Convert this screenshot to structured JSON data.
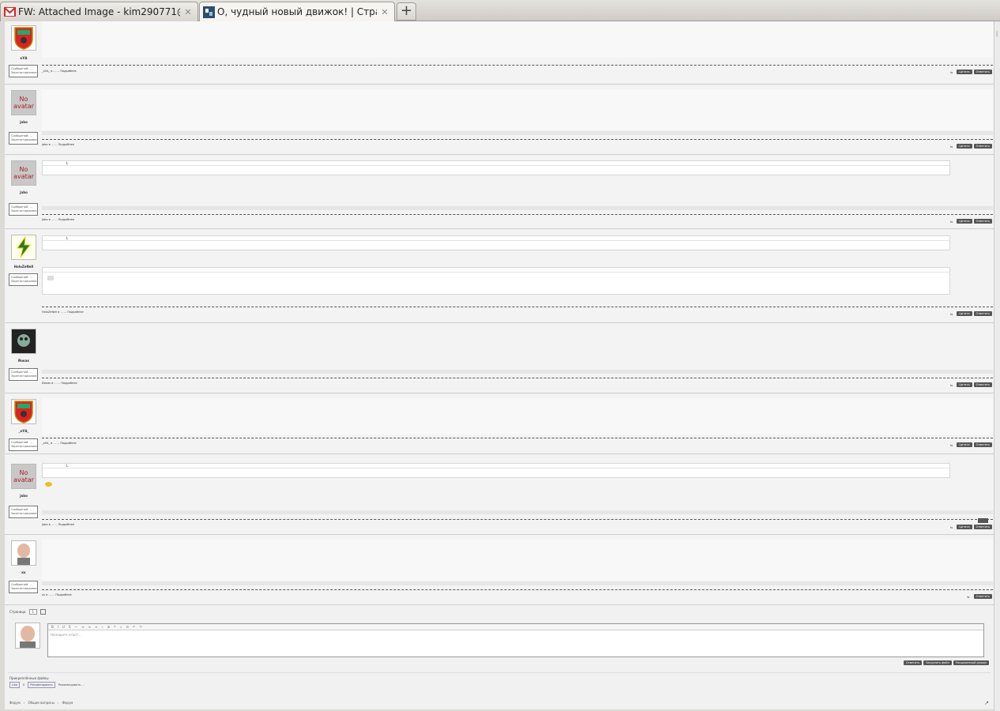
{
  "tabs": [
    {
      "title": "FW: Attached Image - kim290771@gmail...",
      "icon": "gmail-icon",
      "active": false
    },
    {
      "title": "О, чудный новый движок! | Страница ...",
      "icon": "site-icon",
      "active": true
    }
  ],
  "posts": [
    {
      "author": "кУА",
      "avatar": "coat-of-arms",
      "stats": [
        "Сообщений: ...",
        "Зарегистрирован: ..."
      ],
      "meta": "_кУА_ в ... ... Подробнее",
      "buttons": [
        "Цитата",
        "Ответить"
      ]
    },
    {
      "author": "jabo",
      "avatar": "no-avatar",
      "stats": [
        "Сообщений: ...",
        "Зарегистрирован: ..."
      ],
      "meta": "jabo в ... ... Подробнее",
      "buttons": [
        "Цитата",
        "Ответить"
      ]
    },
    {
      "author": "jabo",
      "avatar": "no-avatar",
      "stats": [
        "Сообщений: ...",
        "Зарегистрирован: ..."
      ],
      "meta": "jabo в ... ... Подробнее",
      "buttons": [
        "Цитата",
        "Ответить"
      ]
    },
    {
      "author": "HoloZeNell",
      "avatar": "lightning",
      "stats": [
        "Сообщений: ...",
        "Зарегистрирован: ..."
      ],
      "meta": "HoloZeNell в ... ... Подробнее",
      "buttons": [
        "Цитата",
        "Ответить"
      ]
    },
    {
      "author": "Йокак",
      "avatar": "dark",
      "stats": [
        "Сообщений: ...",
        "Зарегистрирован: ..."
      ],
      "meta": "Йокак в ... ... Подробнее",
      "buttons": [
        "Цитата",
        "Ответить"
      ]
    },
    {
      "author": "_кУА_",
      "avatar": "coat-of-arms",
      "stats": [
        "Сообщений: ...",
        "Зарегистрирован: ..."
      ],
      "meta": "_кУА_ в ... ... Подробнее",
      "buttons": [
        "Цитата",
        "Ответить"
      ]
    },
    {
      "author": "jabo",
      "avatar": "no-avatar",
      "stats": [
        "Сообщений: ...",
        "Зарегистрирован: ..."
      ],
      "meta": "jabo в ... ... Подробнее",
      "buttons": [
        "Цитата",
        "Ответить"
      ]
    },
    {
      "author": "кк",
      "avatar": "photo",
      "stats": [
        "Сообщений: ...",
        "Зарегистрирован: ..."
      ],
      "meta": "кк в ... ... Подробнее",
      "buttons": [
        "Ответить"
      ]
    }
  ],
  "no_avatar_text": "No avatar",
  "quote_head": "L",
  "editor": {
    "pager_label": "Страница",
    "pager_value": "1",
    "placeholder": "Напишите ответ...",
    "toolbar": [
      "B",
      "I",
      "U",
      "S",
      "—",
      "≡",
      "≡",
      "≡",
      "⌁",
      "⊞",
      "❝",
      "‹›",
      "⊟",
      "↶",
      "↷"
    ],
    "buttons": [
      "Ответить",
      "Загрузить файл",
      "Расширенный режим"
    ],
    "info": "Прикреплённые файлы",
    "share": [
      "Like",
      "0",
      "Рекомендовать",
      "Рекомендовать ..."
    ]
  },
  "breadcrumbs": [
    "Форум",
    "Общие вопросы",
    "Форум"
  ]
}
